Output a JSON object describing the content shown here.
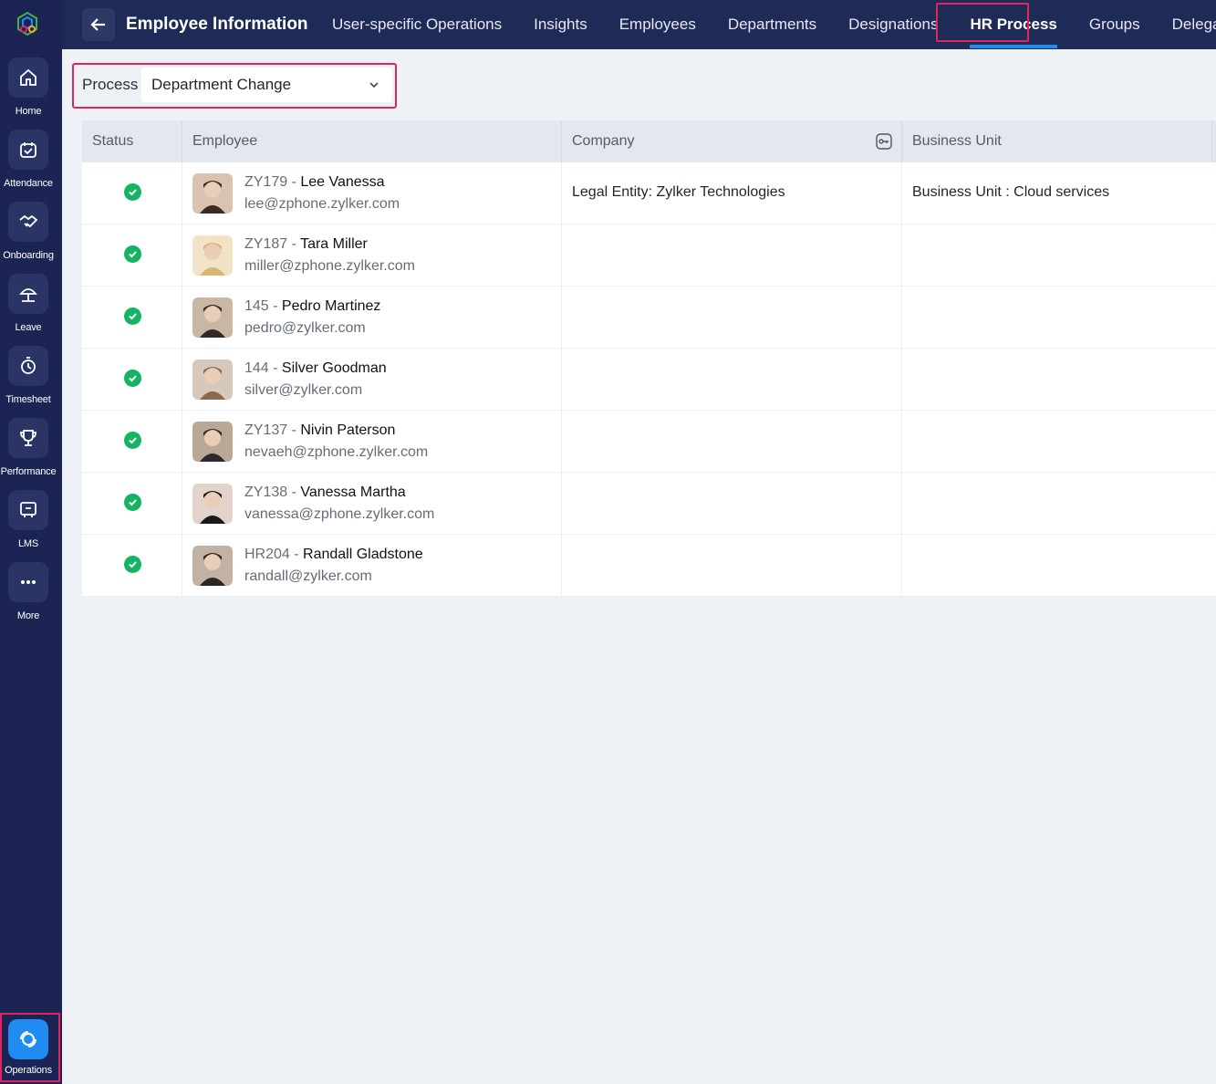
{
  "sidebar": {
    "items": [
      {
        "label": "Home",
        "icon": "home-icon"
      },
      {
        "label": "Attendance",
        "icon": "calendar-check-icon"
      },
      {
        "label": "Onboarding",
        "icon": "handshake-icon"
      },
      {
        "label": "Leave",
        "icon": "umbrella-icon"
      },
      {
        "label": "Timesheet",
        "icon": "stopwatch-icon"
      },
      {
        "label": "Performance",
        "icon": "trophy-icon"
      },
      {
        "label": "LMS",
        "icon": "learning-board-icon"
      },
      {
        "label": "More",
        "icon": "more-dots-icon"
      }
    ],
    "active": {
      "label": "Operations",
      "icon": "operations-icon"
    }
  },
  "header": {
    "title": "Employee Information",
    "tabs": [
      "User-specific Operations",
      "Insights",
      "Employees",
      "Departments",
      "Designations",
      "HR Process",
      "Groups",
      "Delegation"
    ],
    "active_tab": "HR Process"
  },
  "filter": {
    "label": "Process",
    "value": "Department Change"
  },
  "table": {
    "columns": [
      "Status",
      "Employee",
      "Company",
      "Business Unit"
    ],
    "rows": [
      {
        "id": "ZY179",
        "name": "Lee Vanessa",
        "email": "lee@zphone.zylker.com",
        "company": "Legal Entity: Zylker Technologies",
        "business_unit": "Business Unit : Cloud services"
      },
      {
        "id": "ZY187",
        "name": "Tara Miller",
        "email": "miller@zphone.zylker.com",
        "company": "",
        "business_unit": ""
      },
      {
        "id": "145",
        "name": "Pedro Martinez",
        "email": "pedro@zylker.com",
        "company": "",
        "business_unit": ""
      },
      {
        "id": "144",
        "name": "Silver Goodman",
        "email": "silver@zylker.com",
        "company": "",
        "business_unit": ""
      },
      {
        "id": "ZY137",
        "name": "Nivin Paterson",
        "email": "nevaeh@zphone.zylker.com",
        "company": "",
        "business_unit": ""
      },
      {
        "id": "ZY138",
        "name": "Vanessa Martha",
        "email": "vanessa@zphone.zylker.com",
        "company": "",
        "business_unit": ""
      },
      {
        "id": "HR204",
        "name": "Randall Gladstone",
        "email": "randall@zylker.com",
        "company": "",
        "business_unit": ""
      }
    ]
  },
  "colors": {
    "sidebar_bg": "#1b2453",
    "topbar_bg": "#1f2b57",
    "accent": "#1e8cf0",
    "highlight": "#e0245e",
    "status_ok": "#16b364"
  }
}
